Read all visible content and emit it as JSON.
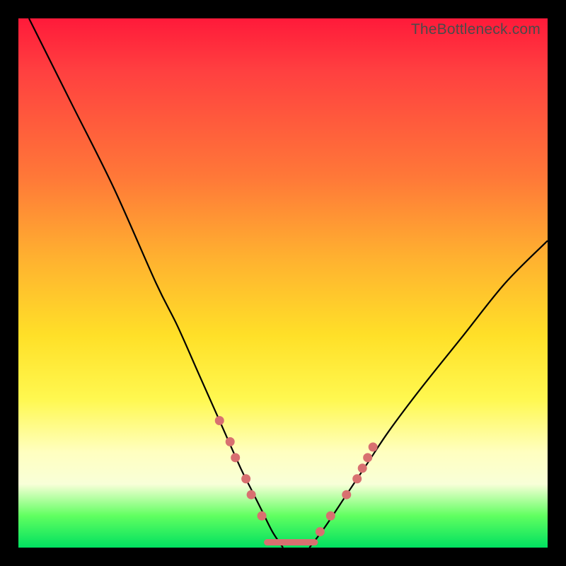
{
  "watermark": "TheBottleneck.com",
  "chart_data": {
    "type": "line",
    "title": "",
    "xlabel": "",
    "ylabel": "",
    "xlim": [
      0,
      100
    ],
    "ylim": [
      0,
      100
    ],
    "grid": false,
    "legend": false,
    "series": [
      {
        "name": "left-curve",
        "x": [
          2,
          10,
          18,
          26,
          30,
          34,
          38,
          42,
          44,
          46,
          48,
          50
        ],
        "values": [
          100,
          84,
          68,
          50,
          42,
          33,
          24,
          15,
          11,
          7,
          3,
          0
        ]
      },
      {
        "name": "right-curve",
        "x": [
          55,
          58,
          62,
          66,
          70,
          76,
          84,
          92,
          100
        ],
        "values": [
          0,
          4,
          10,
          16,
          22,
          30,
          40,
          50,
          58
        ]
      },
      {
        "name": "flat-bottom",
        "x": [
          47,
          56
        ],
        "values": [
          1,
          1
        ]
      }
    ],
    "markers_left": [
      {
        "x": 38,
        "y": 24
      },
      {
        "x": 40,
        "y": 20
      },
      {
        "x": 41,
        "y": 17
      },
      {
        "x": 43,
        "y": 13
      },
      {
        "x": 44,
        "y": 10
      },
      {
        "x": 46,
        "y": 6
      }
    ],
    "markers_right": [
      {
        "x": 57,
        "y": 3
      },
      {
        "x": 59,
        "y": 6
      },
      {
        "x": 62,
        "y": 10
      },
      {
        "x": 64,
        "y": 13
      },
      {
        "x": 65,
        "y": 15
      },
      {
        "x": 66,
        "y": 17
      },
      {
        "x": 67,
        "y": 19
      }
    ],
    "plot_bg_stops": [
      {
        "pos": 0,
        "color": "#ff1a3a"
      },
      {
        "pos": 30,
        "color": "#ff7838"
      },
      {
        "pos": 60,
        "color": "#ffe028"
      },
      {
        "pos": 85,
        "color": "#ffffc0"
      },
      {
        "pos": 100,
        "color": "#00e060"
      }
    ]
  }
}
